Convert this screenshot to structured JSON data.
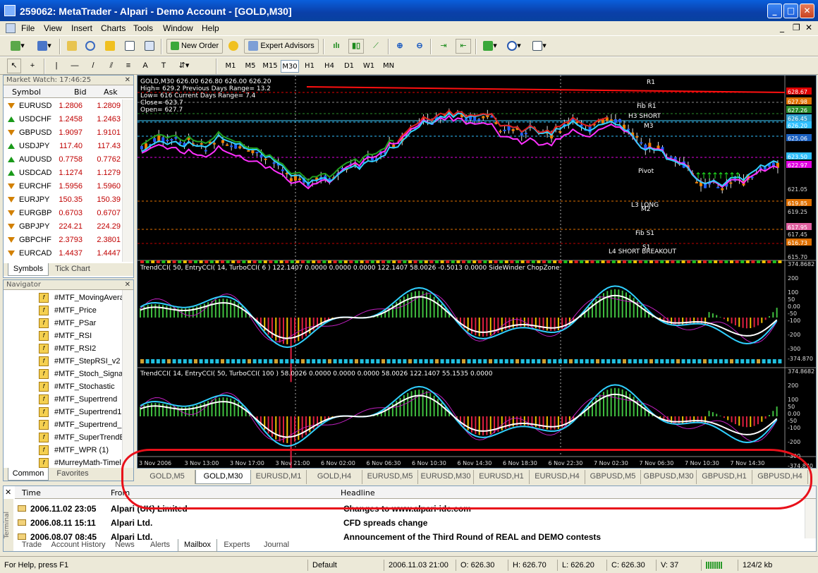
{
  "window": {
    "title": "259062: MetaTrader - Alpari - Demo Account - [GOLD,M30]"
  },
  "menu": [
    "File",
    "View",
    "Insert",
    "Charts",
    "Tools",
    "Window",
    "Help"
  ],
  "toolbar": {
    "new_order": "New Order",
    "expert_advisors": "Expert Advisors"
  },
  "timeframes": [
    "M1",
    "M5",
    "M15",
    "M30",
    "H1",
    "H4",
    "D1",
    "W1",
    "MN"
  ],
  "selected_timeframe": "M30",
  "market_watch": {
    "title": "Market Watch: 17:46:25",
    "cols": {
      "symbol": "Symbol",
      "bid": "Bid",
      "ask": "Ask"
    },
    "rows": [
      {
        "symbol": "EURUSD",
        "bid": "1.2806",
        "ask": "1.2809",
        "dir": "down"
      },
      {
        "symbol": "USDCHF",
        "bid": "1.2458",
        "ask": "1.2463",
        "dir": "up"
      },
      {
        "symbol": "GBPUSD",
        "bid": "1.9097",
        "ask": "1.9101",
        "dir": "down"
      },
      {
        "symbol": "USDJPY",
        "bid": "117.40",
        "ask": "117.43",
        "dir": "up"
      },
      {
        "symbol": "AUDUSD",
        "bid": "0.7758",
        "ask": "0.7762",
        "dir": "up"
      },
      {
        "symbol": "USDCAD",
        "bid": "1.1274",
        "ask": "1.1279",
        "dir": "up"
      },
      {
        "symbol": "EURCHF",
        "bid": "1.5956",
        "ask": "1.5960",
        "dir": "down"
      },
      {
        "symbol": "EURJPY",
        "bid": "150.35",
        "ask": "150.39",
        "dir": "down"
      },
      {
        "symbol": "EURGBP",
        "bid": "0.6703",
        "ask": "0.6707",
        "dir": "down"
      },
      {
        "symbol": "GBPJPY",
        "bid": "224.21",
        "ask": "224.29",
        "dir": "down"
      },
      {
        "symbol": "GBPCHF",
        "bid": "2.3793",
        "ask": "2.3801",
        "dir": "down"
      },
      {
        "symbol": "EURCAD",
        "bid": "1.4437",
        "ask": "1.4447",
        "dir": "down"
      }
    ],
    "tabs": [
      "Symbols",
      "Tick Chart"
    ]
  },
  "navigator": {
    "title": "Navigator",
    "items": [
      "#MTF_MovingAvera",
      "#MTF_Price",
      "#MTF_PSar",
      "#MTF_RSI",
      "#MTF_RSI2",
      "#MTF_StepRSI_v2",
      "#MTF_Stoch_Signa",
      "#MTF_Stochastic",
      "#MTF_Supertrend",
      "#MTF_Supertrend1",
      "#MTF_Supertrend_",
      "#MTF_SuperTrendE",
      "#MTF_WPR (1)",
      "#MurreyMath-Timel"
    ],
    "tabs": [
      "Common",
      "Favorites"
    ]
  },
  "chart": {
    "info_line1": "GOLD,M30  626.00 626.80 626.00 626.20",
    "info_line2": "High= 629.2    Previous Days Range= 13.2",
    "info_line3": "Low= 616    Current Days Range= 7.4",
    "info_line4": "Close= 623.7",
    "info_line5": "Open= 627.7",
    "levels": [
      {
        "label": "R1",
        "price": ""
      },
      {
        "label": "Fib R1",
        "price": "627.98"
      },
      {
        "label": "H3 SHORT",
        "price": "627.26"
      },
      {
        "label": "M3",
        "price": "626.45"
      },
      {
        "label": "Pivot",
        "price": ""
      },
      {
        "label": "L3 LONG",
        "price": "619.85"
      },
      {
        "label": "M2",
        "price": ""
      },
      {
        "label": "Fib S1",
        "price": "617.95"
      },
      {
        "label": "S1",
        "price": "616.73"
      },
      {
        "label": "L4 SHORT BREAKOUT",
        "price": ""
      }
    ],
    "price_axis": [
      "628.67",
      "627.98",
      "627.26",
      "626.45",
      "626.20",
      "625.06",
      "623.50",
      "622.97",
      "621.05",
      "619.85",
      "619.25",
      "617.95",
      "617.45",
      "616.73",
      "615.70"
    ],
    "sub1_label": "TrendCCI( 50, EntryCCI( 14, TurboCCI( 6 )  122.1407 0.0000 0.0000 0.0000 122.1407 58.0026 -0.5013 0.0000  SideWinder  ChopZone",
    "sub1_axis": [
      "374.8682",
      "200",
      "100",
      "50",
      "0.00",
      "-50",
      "-100",
      "-200",
      "-300",
      "-374.870"
    ],
    "sub2_label": "TrendCCI( 14, EntryCCI( 50, TurboCCI( 100 )  58.0026 0.0000 0.0000 0.0000 58.0026 122.1407 55.1535 0.0000",
    "sub2_axis": [
      "374.8682",
      "200",
      "100",
      "50",
      "0.00",
      "-50",
      "-100",
      "-200",
      "-300",
      "-374.870"
    ],
    "time_axis": [
      "3 Nov 2006",
      "3 Nov 13:00",
      "3 Nov 17:00",
      "3 Nov 21:00",
      "6 Nov 02:00",
      "6 Nov 06:30",
      "6 Nov 10:30",
      "6 Nov 14:30",
      "6 Nov 18:30",
      "6 Nov 22:30",
      "7 Nov 02:30",
      "7 Nov 06:30",
      "7 Nov 10:30",
      "7 Nov 14:30"
    ]
  },
  "chart_tabs": [
    "GOLD,M5",
    "GOLD,M30",
    "EURUSD,M1",
    "GOLD,H4",
    "EURUSD,M5",
    "EURUSD,M30",
    "EURUSD,H1",
    "EURUSD,H4",
    "GBPUSD,M5",
    "GBPUSD,M30",
    "GBPUSD,H1",
    "GBPUSD,H4"
  ],
  "active_chart_tab": "GOLD,M30",
  "terminal": {
    "cols": {
      "time": "Time",
      "from": "From",
      "headline": "Headline"
    },
    "rows": [
      {
        "time": "2006.11.02 23:05",
        "from": "Alpari (UK) Limited",
        "headline": "Changes to www.alpari-idc.com"
      },
      {
        "time": "2006.08.11 15:11",
        "from": "Alpari Ltd.",
        "headline": "CFD spreads change"
      },
      {
        "time": "2006.08.07 08:45",
        "from": "Alpari Ltd.",
        "headline": "Announcement of the Third Round of REAL and DEMO contests"
      }
    ],
    "side_label": "Terminal",
    "tabs": [
      "Trade",
      "Account History",
      "News",
      "Alerts",
      "Mailbox",
      "Experts",
      "Journal"
    ],
    "active_tab": "Mailbox"
  },
  "status": {
    "help": "For Help, press F1",
    "profile": "Default",
    "datetime": "2006.11.03 21:00",
    "o": "O: 626.30",
    "h": "H: 626.70",
    "l": "L: 626.20",
    "c": "C: 626.30",
    "v": "V: 37",
    "traffic": "124/2 kb"
  }
}
